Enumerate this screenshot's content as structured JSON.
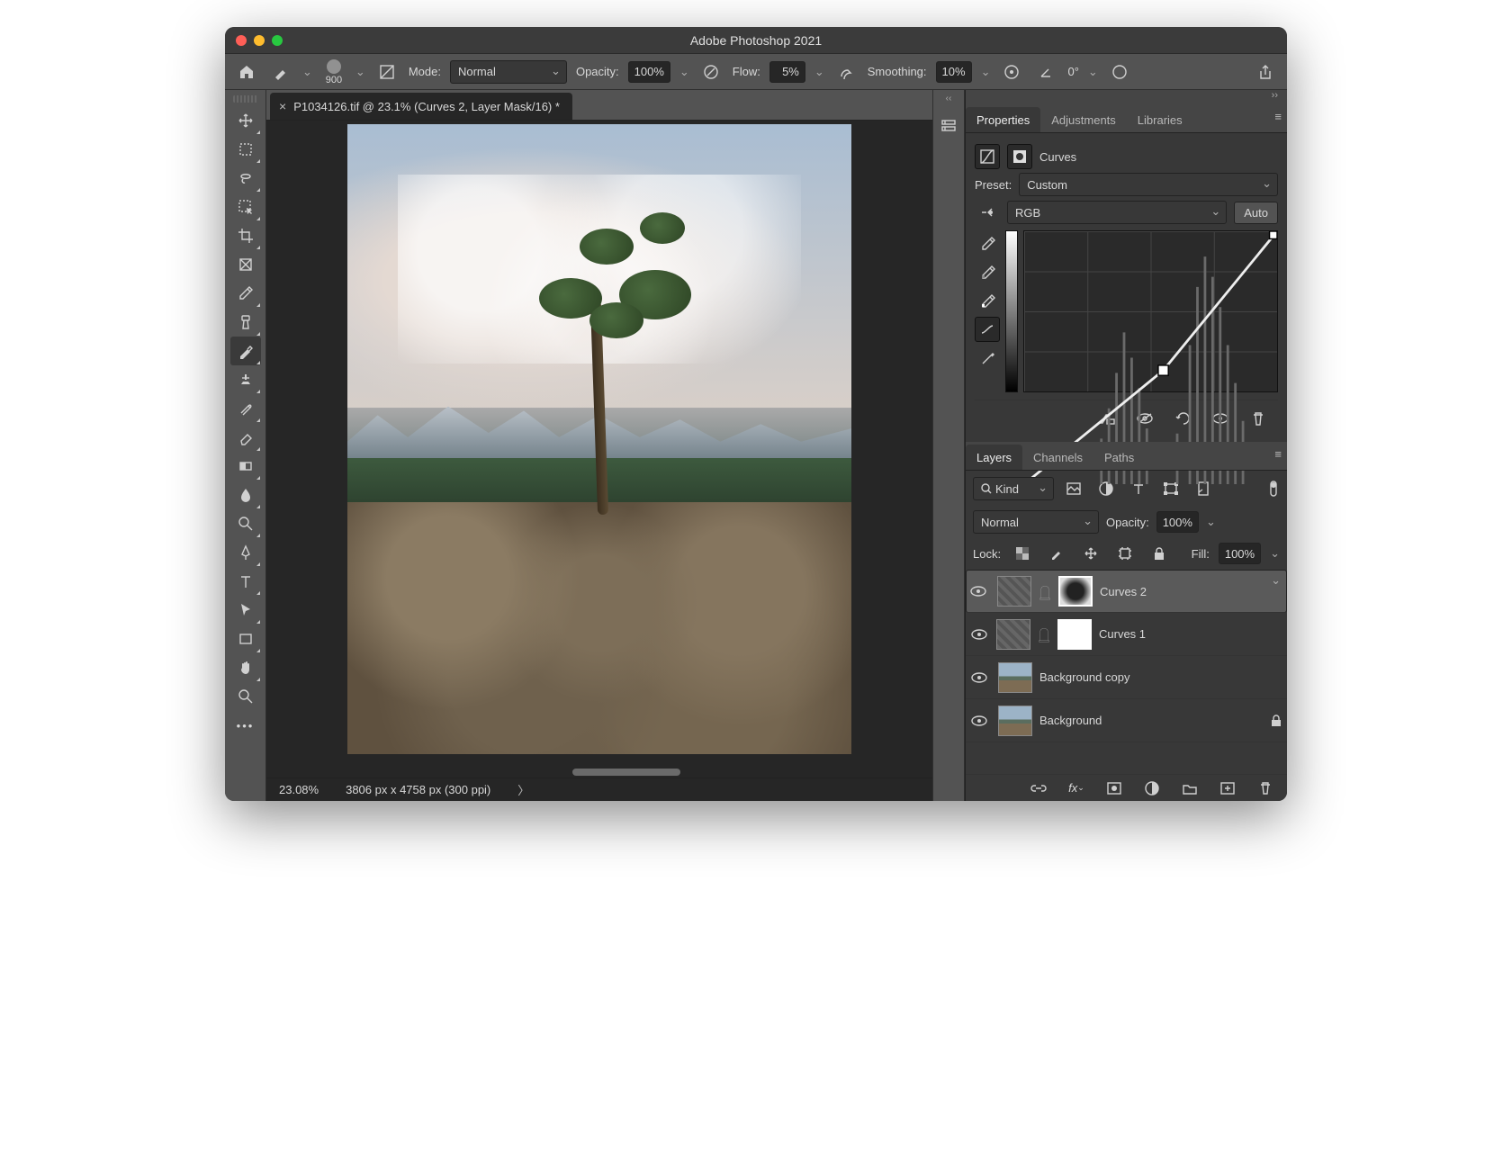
{
  "window": {
    "title": "Adobe Photoshop 2021"
  },
  "traffic": {
    "close": "#ff5f57",
    "min": "#febc2e",
    "max": "#28c840"
  },
  "options": {
    "brush_size": "900",
    "mode_label": "Mode:",
    "mode_value": "Normal",
    "opacity_label": "Opacity:",
    "opacity_value": "100%",
    "flow_label": "Flow:",
    "flow_value": "5%",
    "smoothing_label": "Smoothing:",
    "smoothing_value": "10%",
    "angle_value": "0°"
  },
  "doc": {
    "tab_title": "P1034126.tif @ 23.1% (Curves 2, Layer Mask/16) *"
  },
  "status": {
    "zoom": "23.08%",
    "dims": "3806 px x 4758 px (300 ppi)"
  },
  "panels": {
    "top_tabs": [
      "Properties",
      "Adjustments",
      "Libraries"
    ],
    "top_active": 0,
    "properties": {
      "type_label": "Curves",
      "preset_label": "Preset:",
      "preset_value": "Custom",
      "channel_value": "RGB",
      "auto_label": "Auto"
    },
    "bottom_tabs": [
      "Layers",
      "Channels",
      "Paths"
    ],
    "bottom_active": 0,
    "layers": {
      "filter_value": "Kind",
      "blend_value": "Normal",
      "opacity_label": "Opacity:",
      "opacity_value": "100%",
      "lock_label": "Lock:",
      "fill_label": "Fill:",
      "fill_value": "100%",
      "items": [
        {
          "name": "Curves 2",
          "type": "adj",
          "mask": "dark",
          "selected": true
        },
        {
          "name": "Curves 1",
          "type": "adj",
          "mask": "white",
          "selected": false
        },
        {
          "name": "Background copy",
          "type": "img",
          "selected": false
        },
        {
          "name": "Background",
          "type": "img",
          "locked": true,
          "selected": false
        }
      ]
    }
  }
}
